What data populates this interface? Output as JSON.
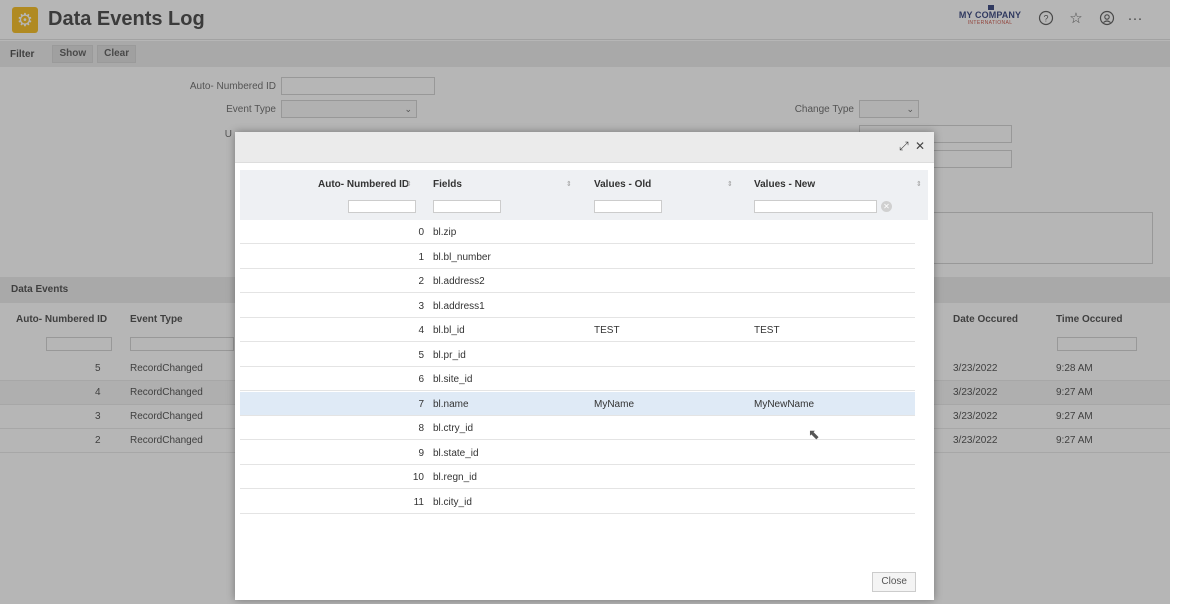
{
  "app": {
    "title": "Data Events Log",
    "logo_icon": "gear-icon"
  },
  "company": {
    "line1": "MY COMPANY",
    "line2": "INTERNATIONAL"
  },
  "header_icons": [
    "help-icon",
    "favorites-icon",
    "user-icon",
    "more-icon"
  ],
  "filter": {
    "title": "Filter",
    "show_label": "Show",
    "clear_label": "Clear",
    "auto_id_label": "Auto- Numbered ID",
    "event_type_label": "Event Type",
    "change_type_label": "Change Type",
    "user_label_partial": "U"
  },
  "data_events": {
    "title": "Data Events",
    "columns": {
      "auto_id": "Auto- Numbered ID",
      "event_type": "Event Type",
      "date": "Date Occured",
      "time": "Time Occured"
    },
    "rows": [
      {
        "id": "5",
        "event": "RecordChanged",
        "date": "3/23/2022",
        "time": "9:28 AM"
      },
      {
        "id": "4",
        "event": "RecordChanged",
        "date": "3/23/2022",
        "time": "9:27 AM"
      },
      {
        "id": "3",
        "event": "RecordChanged",
        "date": "3/23/2022",
        "time": "9:27 AM"
      },
      {
        "id": "2",
        "event": "RecordChanged",
        "date": "3/23/2022",
        "time": "9:27 AM"
      }
    ]
  },
  "dialog": {
    "columns": {
      "auto_id": "Auto- Numbered ID",
      "fields": "Fields",
      "old": "Values - Old",
      "new": "Values - New"
    },
    "rows": [
      {
        "id": "0",
        "field": "bl.zip",
        "old": "",
        "new": ""
      },
      {
        "id": "1",
        "field": "bl.bl_number",
        "old": "",
        "new": ""
      },
      {
        "id": "2",
        "field": "bl.address2",
        "old": "",
        "new": ""
      },
      {
        "id": "3",
        "field": "bl.address1",
        "old": "",
        "new": ""
      },
      {
        "id": "4",
        "field": "bl.bl_id",
        "old": "TEST",
        "new": "TEST"
      },
      {
        "id": "5",
        "field": "bl.pr_id",
        "old": "",
        "new": ""
      },
      {
        "id": "6",
        "field": "bl.site_id",
        "old": "",
        "new": ""
      },
      {
        "id": "7",
        "field": "bl.name",
        "old": "MyName",
        "new": "MyNewName"
      },
      {
        "id": "8",
        "field": "bl.ctry_id",
        "old": "",
        "new": ""
      },
      {
        "id": "9",
        "field": "bl.state_id",
        "old": "",
        "new": ""
      },
      {
        "id": "10",
        "field": "bl.regn_id",
        "old": "",
        "new": ""
      },
      {
        "id": "11",
        "field": "bl.city_id",
        "old": "",
        "new": ""
      }
    ],
    "selected_index": 7,
    "close_label": "Close"
  }
}
